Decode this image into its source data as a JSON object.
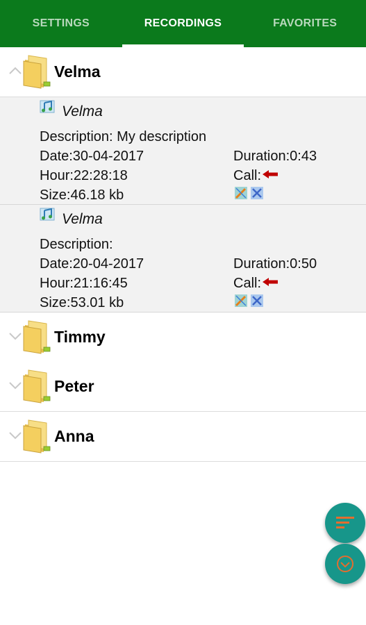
{
  "tabs": [
    {
      "label": "SETTINGS",
      "active": false
    },
    {
      "label": "RECORDINGS",
      "active": true
    },
    {
      "label": "FAVORITES",
      "active": false
    }
  ],
  "groups": [
    {
      "name": "Velma",
      "expanded": true
    },
    {
      "name": "Timmy",
      "expanded": false
    },
    {
      "name": "Peter",
      "expanded": false
    },
    {
      "name": "Anna",
      "expanded": false
    }
  ],
  "recordings": [
    {
      "name": "Velma",
      "description": "Description: My description",
      "date": "Date:30-04-2017",
      "duration": "Duration:0:43",
      "hour": "Hour:22:28:18",
      "call": "Call:",
      "size": "Size:46.18 kb"
    },
    {
      "name": "Velma",
      "description": "Description:",
      "date": "Date:20-04-2017",
      "duration": "Duration:0:50",
      "hour": "Hour:21:16:45",
      "call": "Call:",
      "size": "Size:53.01 kb"
    }
  ],
  "icons": {
    "folder": "folder-icon",
    "note": "music-note-icon",
    "call_direction": "incoming-arrow-icon",
    "fab_top": "sort-icon",
    "fab_bottom": "filter-icon"
  },
  "colors": {
    "primary": "#0b7a1c",
    "accent": "#17968a",
    "arrow": "#c00000"
  }
}
